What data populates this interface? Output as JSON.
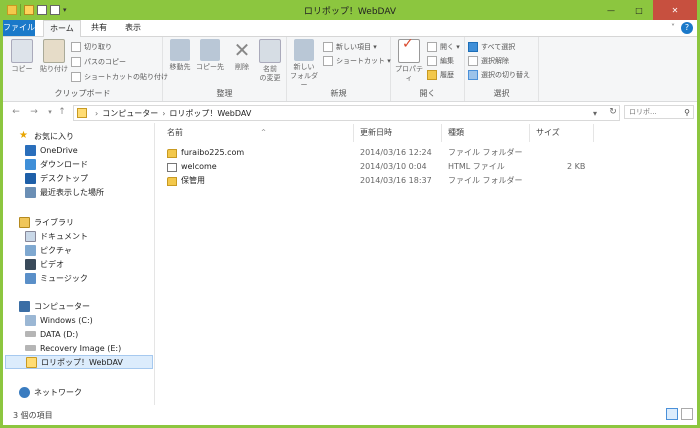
{
  "window": {
    "title": "ロリポップ！WebDAV",
    "minimize_label": "—",
    "maximize_label": "□",
    "close_label": "✕"
  },
  "ribbon": {
    "tabs": [
      {
        "label": "ファイル"
      },
      {
        "label": "ホーム"
      },
      {
        "label": "共有"
      },
      {
        "label": "表示"
      }
    ],
    "help_label": "?",
    "collapse_label": "˅",
    "groups": {
      "clipboard": {
        "label": "クリップボード",
        "copy": "コピー",
        "paste": "貼り付け",
        "cut": "切り取り",
        "copy_path": "パスのコピー",
        "paste_shortcut": "ショートカットの貼り付け"
      },
      "organize": {
        "label": "整理",
        "move_to": "移動先",
        "copy_to": "コピー先",
        "delete": "削除",
        "rename_1": "名前",
        "rename_2": "の変更"
      },
      "new": {
        "label": "新規",
        "new_folder_1": "新しい",
        "new_folder_2": "フォルダー",
        "new_item": "新しい項目 ▾",
        "shortcut": "ショートカット ▾"
      },
      "open": {
        "label": "開く",
        "properties": "プロパティ",
        "open": "開く ▾",
        "edit": "編集",
        "history": "履歴"
      },
      "select": {
        "label": "選択",
        "select_all": "すべて選択",
        "select_none": "選択解除",
        "invert": "選択の切り替え"
      }
    }
  },
  "address": {
    "back": "←",
    "forward": "→",
    "recent": "▾",
    "up": "↑",
    "crumbs": [
      "コンピューター",
      "ロリポップ！WebDAV"
    ],
    "crumb_sep": "›",
    "dropdown": "▾",
    "refresh": "↻",
    "search_placeholder": "ロリポ...",
    "search_icon": "⚲"
  },
  "nav": {
    "favorites": "お気に入り",
    "onedrive": "OneDrive",
    "downloads": "ダウンロード",
    "desktop": "デスクトップ",
    "recent": "最近表示した場所",
    "libraries": "ライブラリ",
    "documents": "ドキュメント",
    "pictures": "ピクチャ",
    "videos": "ビデオ",
    "music": "ミュージック",
    "computer": "コンピューター",
    "drive_c": "Windows (C:)",
    "drive_d": "DATA (D:)",
    "drive_e": "Recovery Image (E:)",
    "webdav": "ロリポップ！WebDAV",
    "network": "ネットワーク"
  },
  "files": {
    "headers": [
      "名前",
      "更新日時",
      "種類",
      "サイズ"
    ],
    "sort_indicator": "^",
    "rows": [
      {
        "name": "furaibo225.com",
        "date": "2014/03/16 12:24",
        "type": "ファイル フォルダー",
        "size": ""
      },
      {
        "name": "welcome",
        "date": "2014/03/10 0:04",
        "type": "HTML ファイル",
        "size": "2 KB"
      },
      {
        "name": "保管用",
        "date": "2014/03/16 18:37",
        "type": "ファイル フォルダー",
        "size": ""
      }
    ]
  },
  "status": {
    "count": "3 個の項目"
  },
  "colors": {
    "accent": "#8cc63f",
    "file_tab": "#1b79c9",
    "selection": "#dcecfc"
  }
}
